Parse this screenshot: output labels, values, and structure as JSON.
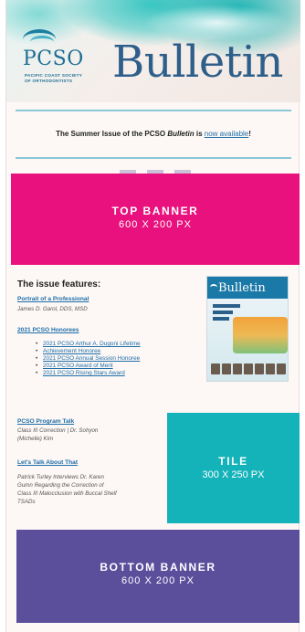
{
  "header": {
    "logo_text": "PCSO",
    "logo_sub_line1": "PACIFIC COAST SOCIETY",
    "logo_sub_line2": "OF ORTHODONTISTS",
    "title": "Bulletin"
  },
  "announcement": {
    "prefix": "The Summer Issue of the PCSO ",
    "italic": "Bulletin",
    "middle": " is ",
    "link": "now available",
    "suffix": "!"
  },
  "top_banner": {
    "label": "TOP BANNER",
    "size": "600 X 200 PX",
    "color": "#e8117d"
  },
  "features": {
    "heading": "The issue features:",
    "portrait": {
      "link": "Portrait of a Professional",
      "byline": "James D. Garol, DDS, MSD"
    },
    "honorees": {
      "link": "2021 PCSO Honorees",
      "items": [
        "2021 PCSO Arthur A. Dugoni Lifetime",
        "Achievement Honoree",
        "2021 PCSO Annual Session Honoree",
        "2021 PCSO Award of Merit",
        "2021 PCSO Rising Stars Award"
      ]
    },
    "program_talk": {
      "link": "PCSO Program Talk",
      "line1": "Class III Correction | Dr. Sohyon",
      "line2": "(Michelle) Kim"
    },
    "lets_talk": {
      "link": "Let's Talk About That",
      "lines": [
        "Patrick Turley Interviews Dr. Karen",
        "Gumn Regarding the Correction of",
        "Class III Malocclusion with Buccal Shelf",
        "TSADs"
      ]
    }
  },
  "cover": {
    "title": "Bulletin"
  },
  "tile": {
    "label": "TILE",
    "size": "300 X 250 PX",
    "color": "#14b3ba"
  },
  "bottom_banner": {
    "label": "BOTTOM BANNER",
    "size": "600 X 200 PX",
    "color": "#5b4f9c"
  }
}
